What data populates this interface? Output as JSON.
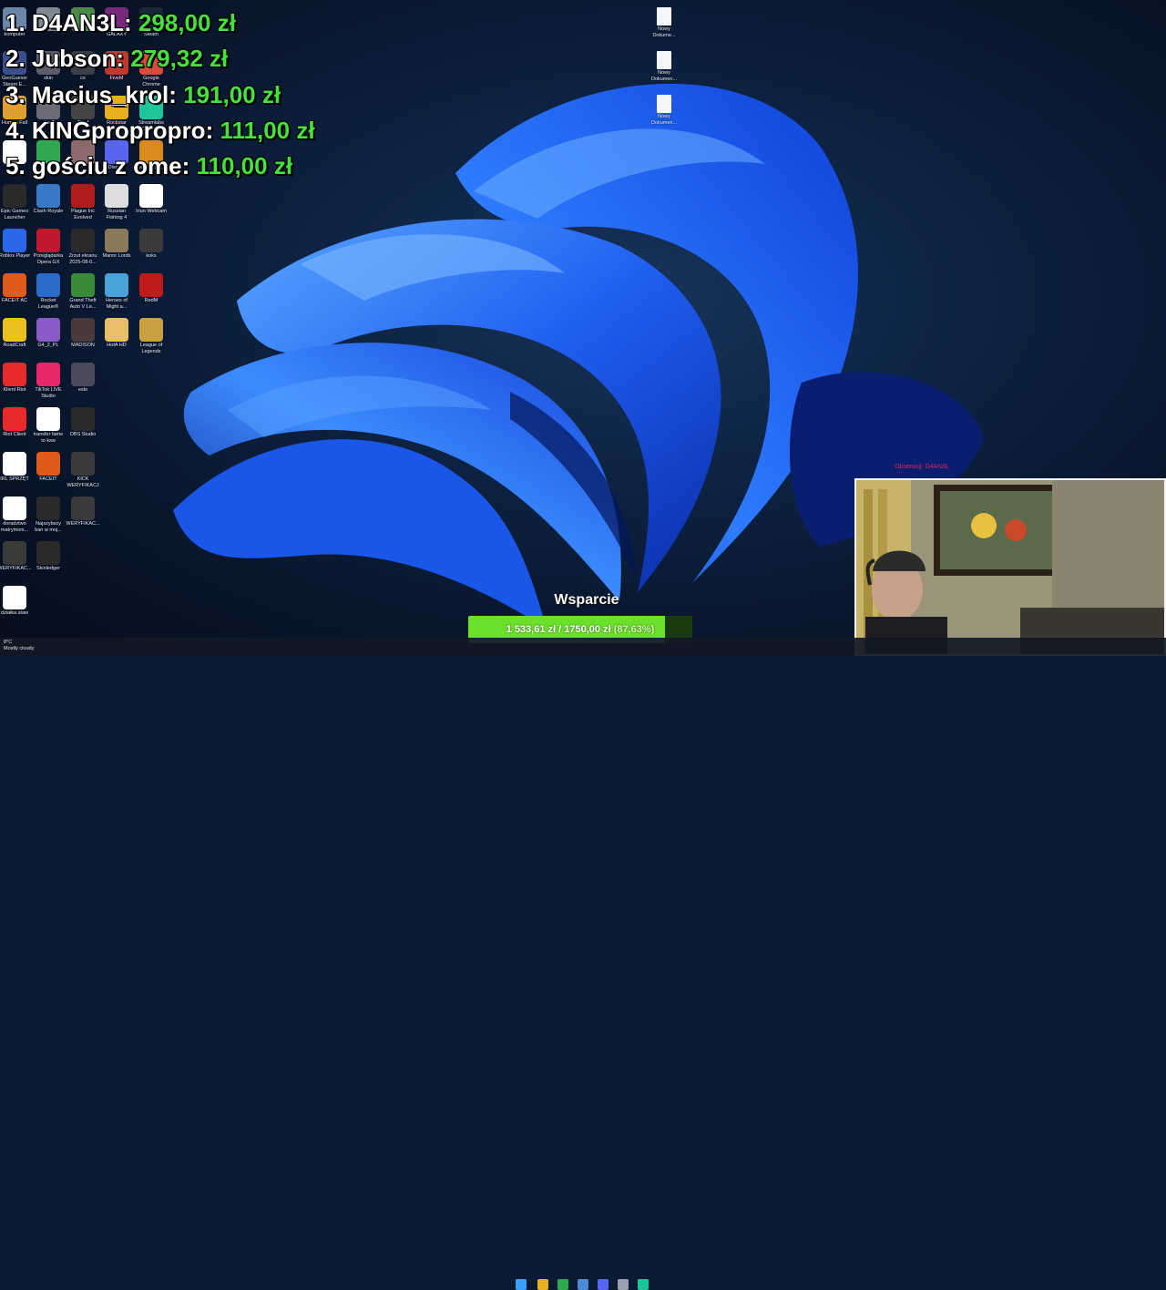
{
  "leaderboard": [
    {
      "rank": "1.",
      "name": "D4AN3L:",
      "amount": "298,00 zł"
    },
    {
      "rank": "2.",
      "name": "Jubson:",
      "amount": "279,32 zł"
    },
    {
      "rank": "3.",
      "name": "Macius_krol:",
      "amount": "191,00 zł"
    },
    {
      "rank": "4.",
      "name": "KINGpropropro:",
      "amount": "111,00 zł"
    },
    {
      "rank": "5.",
      "name": "gościu z ome:",
      "amount": "110,00 zł"
    }
  ],
  "desktop_icons": [
    {
      "label": "komputer",
      "icon": "computer-icon",
      "color": "#6b86a8"
    },
    {
      "label": "",
      "icon": "folder-icon",
      "color": "#7d8a93"
    },
    {
      "label": "",
      "icon": "app-icon",
      "color": "#4b8a46"
    },
    {
      "label": "GALAXY",
      "icon": "galaxy-icon",
      "color": "#7a2a7a"
    },
    {
      "label": "Steam",
      "icon": "steam-icon",
      "color": "#1b2838"
    },
    {
      "label": "GeoGuessr Steam E...",
      "icon": "geoguessr-icon",
      "color": "#3b4f8c"
    },
    {
      "label": "skin",
      "icon": "skin-icon",
      "color": "#5c5c6a"
    },
    {
      "label": "cs",
      "icon": "cs-icon",
      "color": "#3a3f48"
    },
    {
      "label": "FiveM",
      "icon": "fivem-icon",
      "color": "#c0392b"
    },
    {
      "label": "Google Chrome",
      "icon": "chrome-icon",
      "color": "#d94b3b"
    },
    {
      "label": "Human Fall",
      "icon": "human-fall-icon",
      "color": "#e0a030"
    },
    {
      "label": "skin2",
      "icon": "skin-icon",
      "color": "#6a6a78"
    },
    {
      "label": "Thief",
      "icon": "thief-icon",
      "color": "#444444"
    },
    {
      "label": "Rockstar",
      "icon": "rockstar-icon",
      "color": "#e8b020"
    },
    {
      "label": "Streamlabs Desktop",
      "icon": "streamlabs-icon",
      "color": "#1ec59a"
    },
    {
      "label": "",
      "icon": "dice-icon",
      "color": "#ffffff"
    },
    {
      "label": "",
      "icon": "app-icon",
      "color": "#2fa84f"
    },
    {
      "label": "",
      "icon": "character-icon",
      "color": "#8a6a6a"
    },
    {
      "label": "Discord",
      "icon": "discord-icon",
      "color": "#5865f2"
    },
    {
      "label": "Counter-Str... 2",
      "icon": "cs2-icon",
      "color": "#d98a1a"
    },
    {
      "label": "Epic Games Launcher",
      "icon": "epic-games-icon",
      "color": "#2a2a2a"
    },
    {
      "label": "Clash Royale",
      "icon": "clash-royale-icon",
      "color": "#3a78c8"
    },
    {
      "label": "Plague Inc Evolved",
      "icon": "plague-inc-icon",
      "color": "#b01c1c"
    },
    {
      "label": "Russian Fishing 4",
      "icon": "russian-fishing-icon",
      "color": "#dddddd"
    },
    {
      "label": "Iriun Webcam",
      "icon": "webcam-icon",
      "color": "#ffffff"
    },
    {
      "label": "Roblox Player",
      "icon": "roblox-icon",
      "color": "#2a66e8"
    },
    {
      "label": "Przeglądarka Opera GX",
      "icon": "opera-gx-icon",
      "color": "#c0182c"
    },
    {
      "label": "Zrzut ekranu 2025-08-0...",
      "icon": "screenshot-icon",
      "color": "#2a2a2a"
    },
    {
      "label": "Manor Lords",
      "icon": "manor-lords-icon",
      "color": "#8a7a5a"
    },
    {
      "label": "koks",
      "icon": "file-icon",
      "color": "#3a3a3a"
    },
    {
      "label": "FACEIT AC",
      "icon": "faceit-ac-icon",
      "color": "#e05a1a"
    },
    {
      "label": "Rocket League®",
      "icon": "rocket-league-icon",
      "color": "#2a6ac8"
    },
    {
      "label": "Grand Theft Auto V Le...",
      "icon": "gta-v-icon",
      "color": "#3a8a3a"
    },
    {
      "label": "Heroes of Might a...",
      "icon": "heroes-icon",
      "color": "#4aa0d8"
    },
    {
      "label": "RedM",
      "icon": "redm-icon",
      "color": "#c01a1a"
    },
    {
      "label": "RoadCraft",
      "icon": "roadcraft-icon",
      "color": "#e8c020"
    },
    {
      "label": "G4_2_PL",
      "icon": "g4-icon",
      "color": "#8a5ac8"
    },
    {
      "label": "MADISON",
      "icon": "madison-icon",
      "color": "#4a3a3a"
    },
    {
      "label": "HotA HD",
      "icon": "hota-icon",
      "color": "#e8c06a"
    },
    {
      "label": "League of Legends",
      "icon": "lol-icon",
      "color": "#c8a040"
    },
    {
      "label": "Klient Riot",
      "icon": "riot-icon",
      "color": "#e82a2a"
    },
    {
      "label": "TikTok LIVE Studio",
      "icon": "tiktok-icon",
      "color": "#e8286a"
    },
    {
      "label": "eslo",
      "icon": "file-icon",
      "color": "#4a4a5a"
    },
    {
      "label": "Riot Client",
      "icon": "riot-icon",
      "color": "#e82a2a"
    },
    {
      "label": "transfer fame to ksw",
      "icon": "document-icon",
      "color": "#ffffff"
    },
    {
      "label": "OBS Studio",
      "icon": "obs-icon",
      "color": "#2a2a2a"
    },
    {
      "label": "IRL SPRZĘT",
      "icon": "document-icon",
      "color": "#ffffff"
    },
    {
      "label": "FACEIT",
      "icon": "faceit-icon",
      "color": "#e05a1a"
    },
    {
      "label": "KICK WERYFIKACJA",
      "icon": "file-icon",
      "color": "#3a3a3a"
    },
    {
      "label": "doradztwo matrymoni...",
      "icon": "document-icon",
      "color": "#ffffff"
    },
    {
      "label": "Najszybszy ban w moj...",
      "icon": "file-icon",
      "color": "#2a2a2a"
    },
    {
      "label": "WERYFIKAC...",
      "icon": "file-icon",
      "color": "#3a3a3a"
    },
    {
      "label": "WERYFIKAC...",
      "icon": "file-icon",
      "color": "#3a3a3a"
    },
    {
      "label": "Skinledger",
      "icon": "skinledger-icon",
      "color": "#2a2a2a"
    },
    {
      "label": "działka staw",
      "icon": "document-icon",
      "color": "#ffffff"
    }
  ],
  "right_icons": [
    {
      "label": "Nowy Dokume...",
      "icon": "new-document-icon"
    },
    {
      "label": "Nowy Dokumen...",
      "icon": "new-document-icon"
    },
    {
      "label": "Nowy Dokumen...",
      "icon": "new-document-icon"
    }
  ],
  "webcam": {
    "follow_tag": "Obserwuj: D4AN3L"
  },
  "goal": {
    "title": "Wsparcie",
    "current": "1 533,61 zł",
    "separator": "/",
    "target": "1750,00 zł",
    "percent": "(87,63%)",
    "progress": 0.8763,
    "fill_color": "#6be02a"
  },
  "taskbar": {
    "weather_temp": "8°C",
    "weather_status": "Mostly cloudy"
  }
}
